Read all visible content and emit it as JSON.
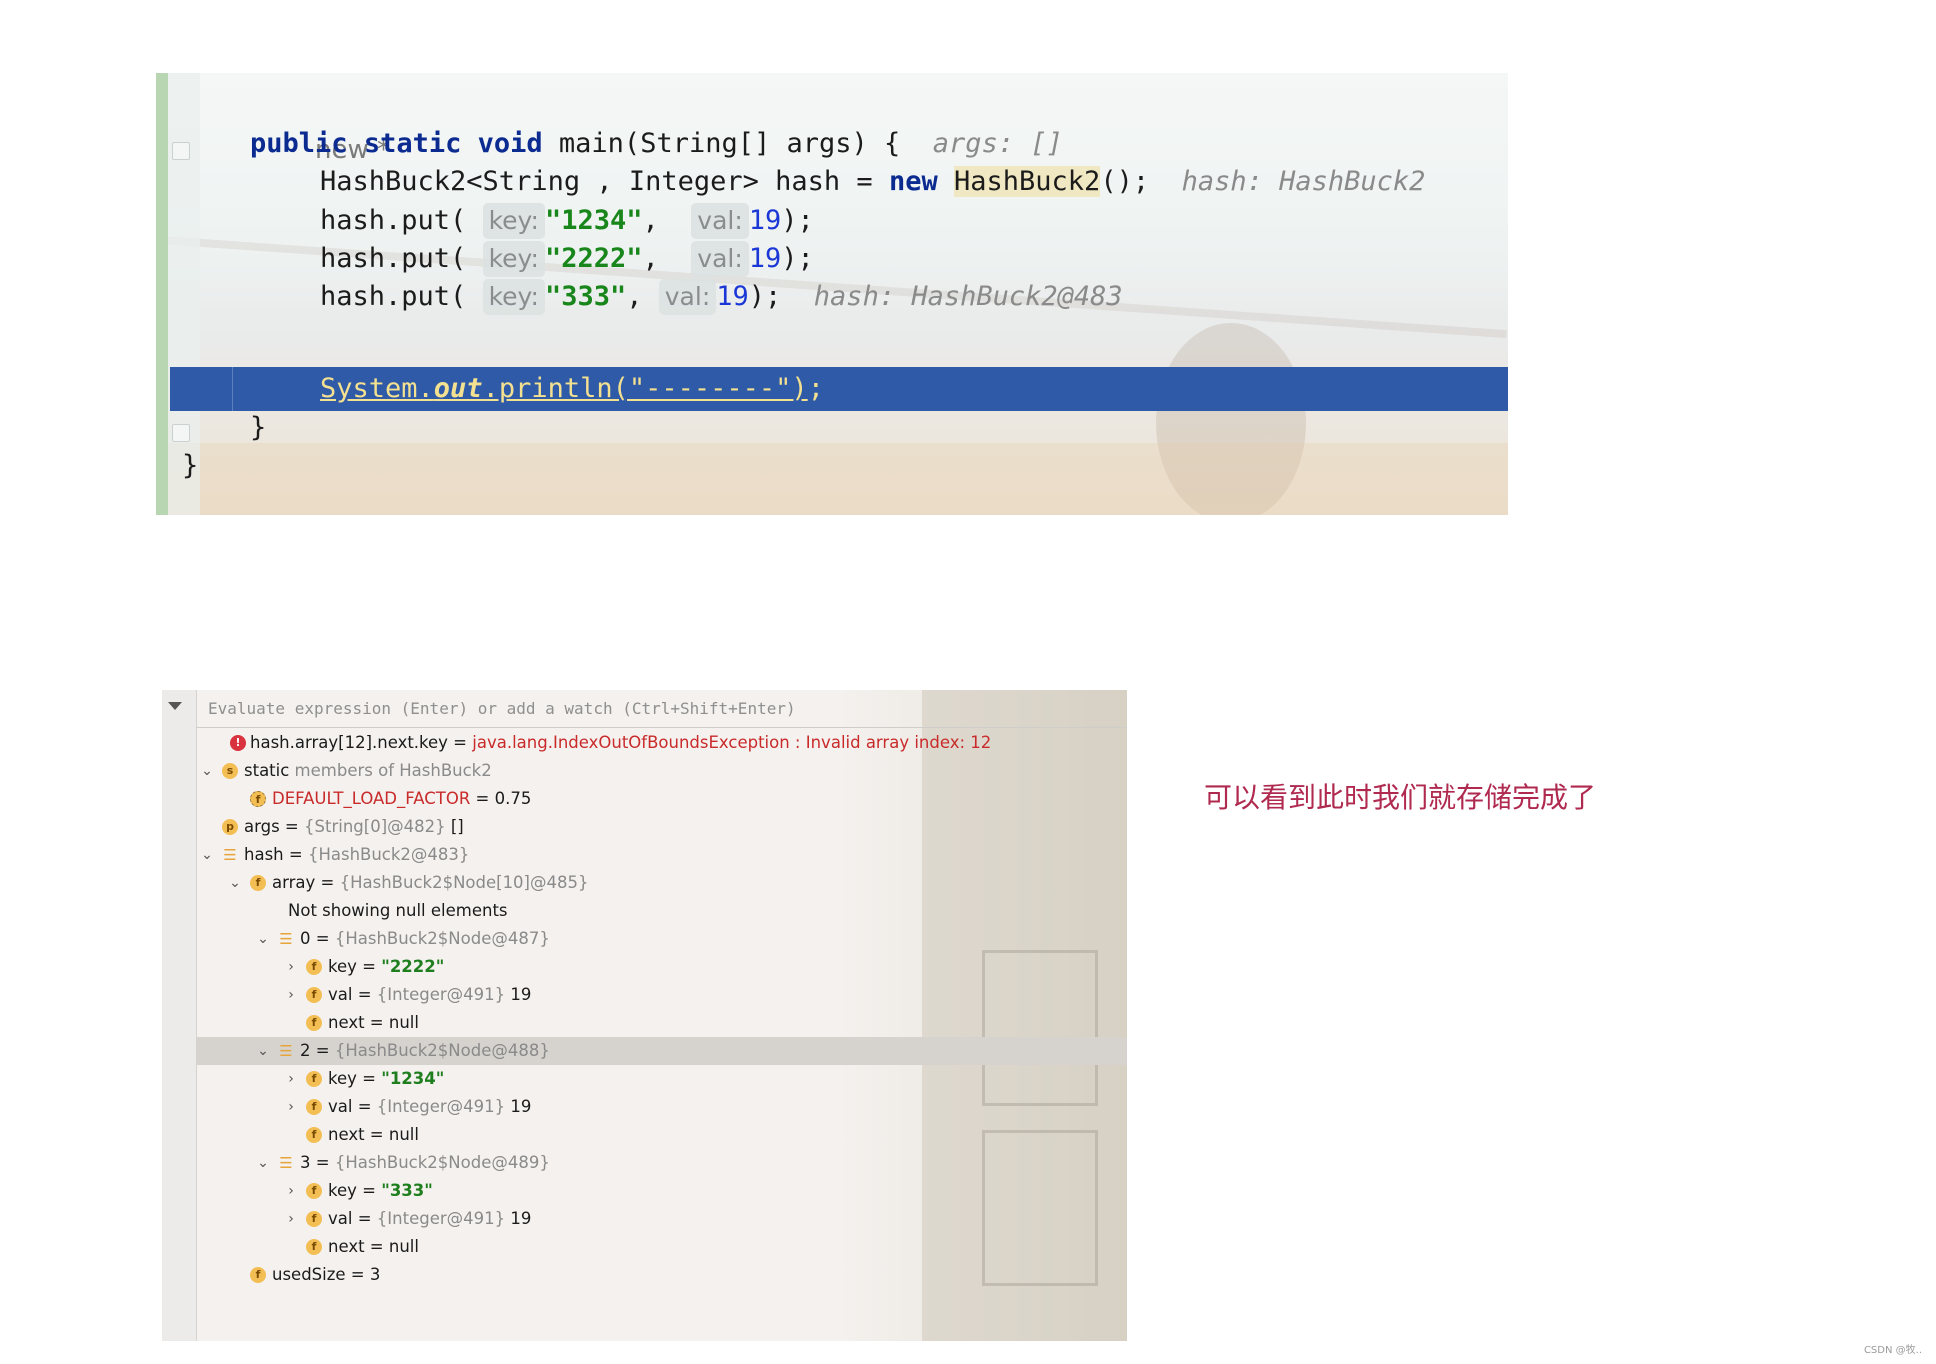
{
  "editor": {
    "comment_new": "new *",
    "line_main": {
      "kw1": "public",
      "kw2": "static",
      "kw3": "void",
      "text": " main(String[] args) {",
      "hint": "args: []"
    },
    "line_decl": {
      "text": "HashBuck2<String , Integer> hash = ",
      "kw": "new",
      "ref": "HashBuck2",
      "tail": "();",
      "hint": "hash: HashBuck2"
    },
    "puts": [
      {
        "prefix": "hash.put(",
        "key_label": "key:",
        "key": "\"1234\"",
        "comma": ",",
        "val_label": "val:",
        "val": "19",
        "end": ");",
        "hint": ""
      },
      {
        "prefix": "hash.put(",
        "key_label": "key:",
        "key": "\"2222\"",
        "comma": ",",
        "val_label": "val:",
        "val": "19",
        "end": ");",
        "hint": ""
      },
      {
        "prefix": "hash.put(",
        "key_label": "key:",
        "key": "\"333\"",
        "comma": ",",
        "val_label": "val:",
        "val": "19",
        "end": ");",
        "hint": "hash: HashBuck2@483"
      }
    ],
    "line_print": {
      "a": "System.",
      "out": "out",
      "b": ".println(\"--------\")",
      "end": ";"
    },
    "close_inner": "}",
    "close_outer": "}"
  },
  "debugger": {
    "eval_placeholder": "Evaluate expression (Enter) or add a watch (Ctrl+Shift+Enter)",
    "rows": {
      "r0": {
        "name": "hash.array[12].next.key",
        "eq": " = ",
        "value": "java.lang.IndexOutOfBoundsException : Invalid array index: 12"
      },
      "r1": {
        "name": "static",
        "gray": " members of HashBuck2"
      },
      "r2": {
        "name": "DEFAULT_LOAD_FACTOR",
        "eq": " = ",
        "value": "0.75"
      },
      "r3": {
        "name": "args",
        "eq": " = ",
        "gray": "{String[0]@482}",
        "value": " []"
      },
      "r4": {
        "name": "hash",
        "eq": " = ",
        "gray": "{HashBuck2@483}"
      },
      "r5": {
        "name": "array",
        "eq": " = ",
        "gray": "{HashBuck2$Node[10]@485}"
      },
      "r6": {
        "name": "Not showing null elements"
      },
      "r7": {
        "name": "0",
        "eq": " = ",
        "gray": "{HashBuck2$Node@487}"
      },
      "r8": {
        "name": "key",
        "eq": " = ",
        "value": "\"2222\""
      },
      "r9": {
        "name": "val",
        "eq": " = ",
        "gray": "{Integer@491}",
        "value": " 19"
      },
      "r10": {
        "name": "next",
        "eq": " = ",
        "value": "null"
      },
      "r11": {
        "name": "2",
        "eq": " = ",
        "gray": "{HashBuck2$Node@488}"
      },
      "r12": {
        "name": "key",
        "eq": " = ",
        "value": "\"1234\""
      },
      "r13": {
        "name": "val",
        "eq": " = ",
        "gray": "{Integer@491}",
        "value": " 19"
      },
      "r14": {
        "name": "next",
        "eq": " = ",
        "value": "null"
      },
      "r15": {
        "name": "3",
        "eq": " = ",
        "gray": "{HashBuck2$Node@489}"
      },
      "r16": {
        "name": "key",
        "eq": " = ",
        "value": "\"333\""
      },
      "r17": {
        "name": "val",
        "eq": " = ",
        "gray": "{Integer@491}",
        "value": " 19"
      },
      "r18": {
        "name": "next",
        "eq": " = ",
        "value": "null"
      },
      "r19": {
        "name": "usedSize",
        "eq": " = ",
        "value": "3"
      }
    },
    "badges": {
      "f": "f",
      "s": "s",
      "p": "p",
      "err": "!"
    }
  },
  "annotation": "可以看到此时我们就存储完成了",
  "watermark": "CSDN @牧.."
}
